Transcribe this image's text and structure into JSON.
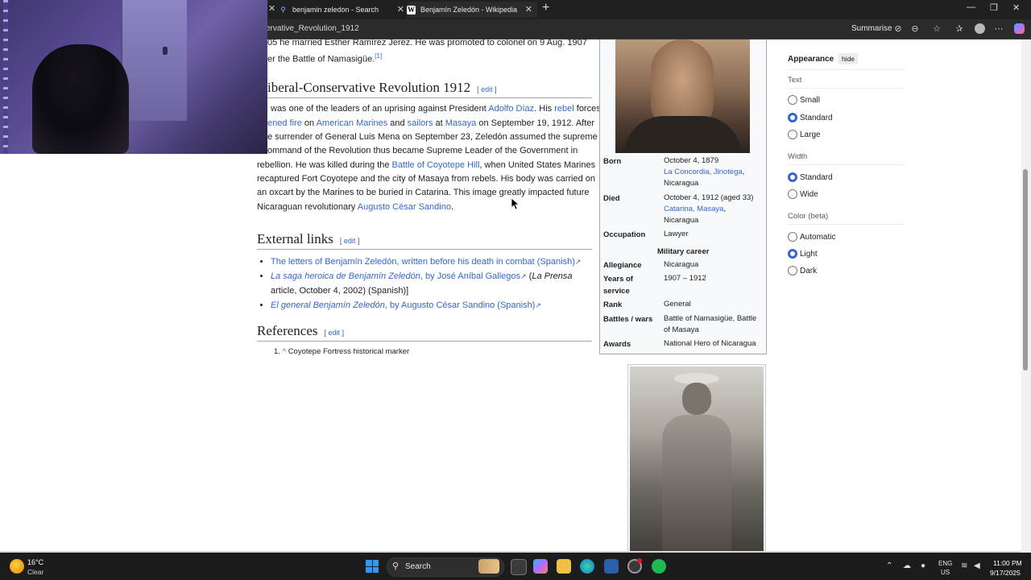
{
  "browser": {
    "tabs": [
      {
        "title": "benjamin zeledon - Search"
      },
      {
        "title": "Benjamín Zeledón - Wikipedia"
      }
    ],
    "url_fragment": "ervative_Revolution_1912",
    "summarise_label": "Summarise"
  },
  "article": {
    "intro_line1": "05 he married Esther Ramírez Jerez. He was promoted to colonel on 9 Aug. 1907",
    "intro_line2": "er the Battle of Namasigüe.",
    "intro_ref": "[1]",
    "section1_title": "iberal-Conservative Revolution 1912",
    "edit_label": "edit",
    "para": [
      {
        "parts": [
          "was one of the leaders of an uprising against President ",
          "Adolfo Díaz",
          ". His ",
          "rebel",
          " forces"
        ]
      },
      {
        "parts": [
          "ened fire",
          " on ",
          "American Marines",
          " and ",
          "sailors",
          " at ",
          "Masaya",
          " on September 19, 1912. After"
        ]
      },
      {
        "parts": [
          "e surrender of General Luis Mena on September 23, Zeledón assumed the supreme"
        ]
      },
      {
        "parts": [
          "ommand of the Revolution thus became Supreme Leader of the Government in"
        ]
      },
      {
        "parts": [
          "rebellion. He was killed during the ",
          "Battle of Coyotepe Hill",
          ", when United States Marines"
        ]
      },
      {
        "parts": [
          "recaptured Fort Coyotepe and the city of Masaya from rebels. His body was carried on"
        ]
      },
      {
        "parts": [
          "an oxcart by the Marines to be buried in Catarina. This image greatly impacted future"
        ]
      },
      {
        "parts": [
          "Nicaraguan revolutionary ",
          "Augusto César Sandino",
          "."
        ]
      }
    ],
    "section2_title": "External links",
    "links": [
      {
        "text": "The letters of Benjamín Zeledón, written before his death in combat (Spanish)"
      },
      {
        "italic": "La saga heroica de Benjamín Zeledón",
        "rest": ", by José Aníbal Gallegos",
        "after_open": " (",
        "after_italic": "La Prensa",
        "line2": "article, October 4, 2002) (Spanish)]"
      },
      {
        "italic": "El general Benjamín Zeledón",
        "rest": ", by Augusto César Sandino (Spanish)"
      }
    ],
    "section3_title": "References",
    "ref1_num": "1.",
    "ref1_caret": "^",
    "ref1_text": "Coyotepe Fortress historical marker"
  },
  "infobox": {
    "born_label": "Born",
    "born_date": "October 4, 1879",
    "born_place_link": "La Concordia, Jinotega",
    "born_country": "Nicaragua",
    "died_label": "Died",
    "died_date": "October 4, 1912 (aged 33)",
    "died_place_link": "Catarina, Masaya",
    "died_country": "Nicaragua",
    "occupation_label": "Occupation",
    "occupation_value": "Lawyer",
    "military_header": "Military career",
    "allegiance_label": "Allegiance",
    "allegiance_value": "Nicaragua",
    "years_label_1": "Years of",
    "years_label_2": "service",
    "years_value": "1907 – 1912",
    "rank_label": "Rank",
    "rank_value": "General",
    "battles_label": "Battles / wars",
    "battles_value_1": "Battle of Namasigüe, Battle",
    "battles_value_2": "of Masaya",
    "awards_label": "Awards",
    "awards_value": "National Hero of Nicaragua"
  },
  "appearance": {
    "title": "Appearance",
    "hide_label": "hide",
    "text_header": "Text",
    "text_options": [
      "Small",
      "Standard",
      "Large"
    ],
    "text_selected": 1,
    "width_header": "Width",
    "width_options": [
      "Standard",
      "Wide"
    ],
    "width_selected": 0,
    "color_header": "Color (beta)",
    "color_options": [
      "Automatic",
      "Light",
      "Dark"
    ],
    "color_selected": 1
  },
  "taskbar": {
    "weather_temp": "16°C",
    "weather_desc": "Clear",
    "search_label": "Search",
    "lang_line1": "ENG",
    "lang_line2": "US",
    "time": "11:00 PM",
    "date": "9/17/2025"
  },
  "colors": {
    "link": "#3366cc",
    "accent_radio": "#3366cc",
    "taskbar": "#1c1c1c"
  }
}
